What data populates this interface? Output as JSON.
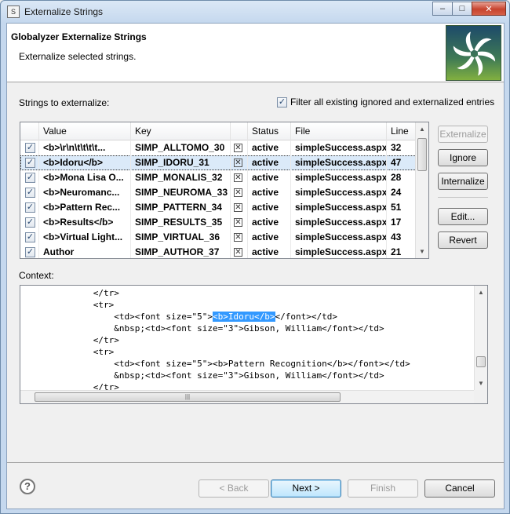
{
  "window": {
    "title": "Externalize Strings",
    "icon_text": "S"
  },
  "header": {
    "title": "Globalyzer Externalize Strings",
    "description": "Externalize selected strings."
  },
  "strings_label": "Strings to externalize:",
  "filter": {
    "label": "Filter all existing ignored and externalized entries",
    "checked": true
  },
  "table": {
    "columns": [
      "Value",
      "Key",
      "",
      "Status",
      "File",
      "Line"
    ],
    "rows": [
      {
        "value": "<b>\\r\\n\\t\\t\\t\\t...",
        "key": "SIMP_ALLTOMO_30",
        "status": "active",
        "file": "simpleSuccess.aspx",
        "line": "32"
      },
      {
        "value": "<b>Idoru</b>",
        "key": "SIMP_IDORU_31",
        "status": "active",
        "file": "simpleSuccess.aspx",
        "line": "47"
      },
      {
        "value": "<b>Mona Lisa O...",
        "key": "SIMP_MONALIS_32",
        "status": "active",
        "file": "simpleSuccess.aspx",
        "line": "28"
      },
      {
        "value": "<b>Neuromanc...",
        "key": "SIMP_NEUROMA_33",
        "status": "active",
        "file": "simpleSuccess.aspx",
        "line": "24"
      },
      {
        "value": "<b>Pattern Rec...",
        "key": "SIMP_PATTERN_34",
        "status": "active",
        "file": "simpleSuccess.aspx",
        "line": "51"
      },
      {
        "value": "<b>Results</b>",
        "key": "SIMP_RESULTS_35",
        "status": "active",
        "file": "simpleSuccess.aspx",
        "line": "17"
      },
      {
        "value": "<b>Virtual Light...",
        "key": "SIMP_VIRTUAL_36",
        "status": "active",
        "file": "simpleSuccess.aspx",
        "line": "43"
      },
      {
        "value": "Author",
        "key": "SIMP_AUTHOR_37",
        "status": "active",
        "file": "simpleSuccess.aspx",
        "line": "21"
      }
    ]
  },
  "side_buttons": {
    "externalize": "Externalize",
    "ignore": "Ignore",
    "internalize": "Internalize",
    "edit": "Edit...",
    "revert": "Revert"
  },
  "context_label": "Context:",
  "context": {
    "lines": [
      "              </tr>",
      "              <tr>",
      "                  <td><font size=\"5\">",
      "                  &nbsp;<td><font size=\"3\">Gibson, William</font></td>",
      "              </tr>",
      "              <tr>",
      "                  <td><font size=\"5\"><b>Pattern Recognition</b></font></td>",
      "                  &nbsp;<td><font size=\"3\">Gibson, William</font></td>",
      "              </tr>"
    ],
    "highlight": "<b>Idoru</b>",
    "after_highlight": "</font></td>"
  },
  "footer": {
    "back": "< Back",
    "next": "Next >",
    "finish": "Finish",
    "cancel": "Cancel"
  },
  "icons": {
    "help": "?",
    "minimize": "–",
    "maximize": "□",
    "close": "✕",
    "check": "✓",
    "xbox": "✕",
    "arrow_up": "▲",
    "arrow_down": "▼",
    "grip": "|||"
  }
}
